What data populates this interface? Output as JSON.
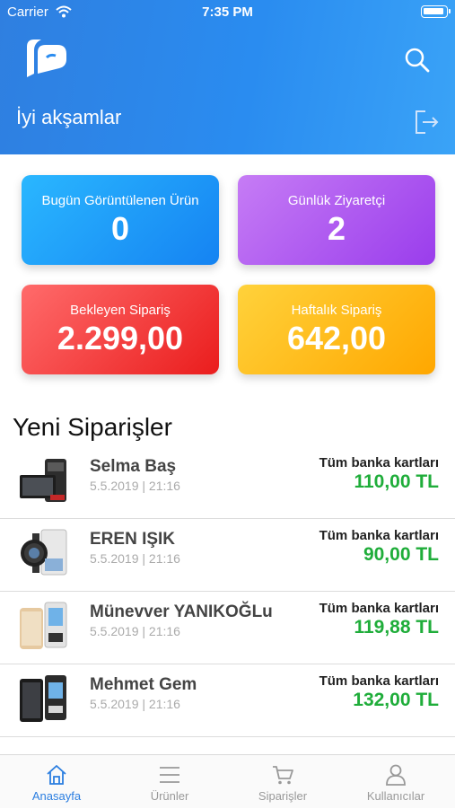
{
  "status_bar": {
    "carrier": "Carrier",
    "time": "7:35 PM"
  },
  "header": {
    "greeting": "İyi akşamlar"
  },
  "stats": [
    {
      "label": "Bugün Görüntülenen Ürün",
      "value": "0"
    },
    {
      "label": "Günlük Ziyaretçi",
      "value": "2"
    },
    {
      "label": "Bekleyen Sipariş",
      "value": "2.299,00"
    },
    {
      "label": "Haftalık Sipariş",
      "value": "642,00"
    }
  ],
  "orders_section": {
    "title": "Yeni Siparişler"
  },
  "orders": [
    {
      "name": "Selma Baş",
      "date": "5.5.2019 | 21:16",
      "payment": "Tüm banka kartları",
      "amount": "110,00 TL"
    },
    {
      "name": "EREN IŞIK",
      "date": "5.5.2019 | 21:16",
      "payment": "Tüm banka kartları",
      "amount": "90,00 TL"
    },
    {
      "name": "Münevver YANIKOĞLu",
      "date": "5.5.2019 | 21:16",
      "payment": "Tüm banka kartları",
      "amount": "119,88 TL"
    },
    {
      "name": "Mehmet Gem",
      "date": "5.5.2019 | 21:16",
      "payment": "Tüm banka kartları",
      "amount": "132,00 TL"
    }
  ],
  "tabs": [
    {
      "label": "Anasayfa",
      "icon": "home-icon"
    },
    {
      "label": "Ürünler",
      "icon": "list-icon"
    },
    {
      "label": "Siparişler",
      "icon": "cart-icon"
    },
    {
      "label": "Kullanıcılar",
      "icon": "user-icon"
    }
  ],
  "colors": {
    "header": "#2a8cf0",
    "accent": "#2b7ee0",
    "amount": "#1fad3a"
  }
}
